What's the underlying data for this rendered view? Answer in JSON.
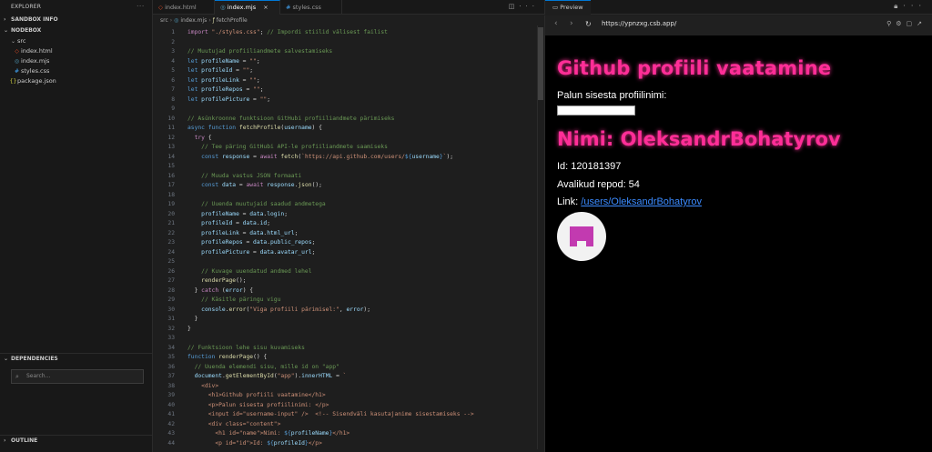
{
  "explorer": {
    "title": "EXPLORER",
    "sandbox_info": "SANDBOX INFO",
    "nodebox": "NODEBOX",
    "tree": [
      {
        "name": "src",
        "type": "folder"
      },
      {
        "name": "index.html",
        "type": "html"
      },
      {
        "name": "index.mjs",
        "type": "js"
      },
      {
        "name": "styles.css",
        "type": "css"
      },
      {
        "name": "package.json",
        "type": "json"
      }
    ],
    "dependencies": "DEPENDENCIES",
    "search_placeholder": "Search...",
    "outline": "OUTLINE"
  },
  "editor": {
    "tabs": [
      {
        "label": "index.html",
        "active": false
      },
      {
        "label": "index.mjs",
        "active": true
      },
      {
        "label": "styles.css",
        "active": false
      }
    ],
    "breadcrumb": [
      "src",
      "index.mjs",
      "fetchProfile"
    ],
    "lines": [
      {
        "n": "1",
        "html": "<span class='kw2'>import</span> <span class='str'>\"./styles.css\"</span>; <span class='com'>// Impordi stiilid välisest failist</span>"
      },
      {
        "n": "2",
        "html": ""
      },
      {
        "n": "3",
        "html": "<span class='com'>// Muutujad profiiliandmete salvestamiseks</span>"
      },
      {
        "n": "4",
        "html": "<span class='kw'>let</span> <span class='var'>profileName</span> = <span class='str'>\"\"</span>;"
      },
      {
        "n": "5",
        "html": "<span class='kw'>let</span> <span class='var'>profileId</span> = <span class='str'>\"\"</span>;"
      },
      {
        "n": "6",
        "html": "<span class='kw'>let</span> <span class='var'>profileLink</span> = <span class='str'>\"\"</span>;"
      },
      {
        "n": "7",
        "html": "<span class='kw'>let</span> <span class='var'>profileRepos</span> = <span class='str'>\"\"</span>;"
      },
      {
        "n": "8",
        "html": "<span class='kw'>let</span> <span class='var'>profilePicture</span> = <span class='str'>\"\"</span>;"
      },
      {
        "n": "9",
        "html": ""
      },
      {
        "n": "10",
        "html": "<span class='com'>// Asünkroonne funktsioon GitHubi profiiliandmete pärimiseks</span>"
      },
      {
        "n": "11",
        "html": "<span class='kw'>async</span> <span class='kw'>function</span> <span class='fn'>fetchProfile</span>(<span class='var'>username</span>) {"
      },
      {
        "n": "12",
        "html": "  <span class='kw2'>try</span> {"
      },
      {
        "n": "13",
        "html": "    <span class='com'>// Tee päring GitHubi API-le profiiliandmete saamiseks</span>"
      },
      {
        "n": "14",
        "html": "    <span class='kw'>const</span> <span class='var'>response</span> = <span class='kw2'>await</span> <span class='fn'>fetch</span>(<span class='str'>`https://api.github.com/users/</span><span class='kw'>${</span><span class='var'>username</span><span class='kw'>}</span><span class='str'>`</span>);"
      },
      {
        "n": "15",
        "html": ""
      },
      {
        "n": "16",
        "html": "    <span class='com'>// Muuda vastus JSON formaati</span>"
      },
      {
        "n": "17",
        "html": "    <span class='kw'>const</span> <span class='var'>data</span> = <span class='kw2'>await</span> <span class='var'>response</span>.<span class='fn'>json</span>();"
      },
      {
        "n": "18",
        "html": ""
      },
      {
        "n": "19",
        "html": "    <span class='com'>// Uuenda muutujaid saadud andmetega</span>"
      },
      {
        "n": "20",
        "html": "    <span class='var'>profileName</span> = <span class='var'>data</span>.<span class='var'>login</span>;"
      },
      {
        "n": "21",
        "html": "    <span class='var'>profileId</span> = <span class='var'>data</span>.<span class='var'>id</span>;"
      },
      {
        "n": "22",
        "html": "    <span class='var'>profileLink</span> = <span class='var'>data</span>.<span class='var'>html_url</span>;"
      },
      {
        "n": "23",
        "html": "    <span class='var'>profileRepos</span> = <span class='var'>data</span>.<span class='var'>public_repos</span>;"
      },
      {
        "n": "24",
        "html": "    <span class='var'>profilePicture</span> = <span class='var'>data</span>.<span class='var'>avatar_url</span>;"
      },
      {
        "n": "25",
        "html": ""
      },
      {
        "n": "26",
        "html": "    <span class='com'>// Kuvage uuendatud andmed lehel</span>"
      },
      {
        "n": "27",
        "html": "    <span class='fn'>renderPage</span>();"
      },
      {
        "n": "28",
        "html": "  } <span class='kw2'>catch</span> (<span class='var'>error</span>) {"
      },
      {
        "n": "29",
        "html": "    <span class='com'>// Käsitle päringu vigu</span>"
      },
      {
        "n": "30",
        "html": "    <span class='var'>console</span>.<span class='fn'>error</span>(<span class='str'>\"Viga profiili pärimisel:\"</span>, <span class='var'>error</span>);"
      },
      {
        "n": "31",
        "html": "  }"
      },
      {
        "n": "32",
        "html": "}"
      },
      {
        "n": "33",
        "html": ""
      },
      {
        "n": "34",
        "html": "<span class='com'>// Funktsioon lehe sisu kuvamiseks</span>"
      },
      {
        "n": "35",
        "html": "<span class='kw'>function</span> <span class='fn'>renderPage</span>() {"
      },
      {
        "n": "36",
        "html": "  <span class='com'>// Uuenda elemendi sisu, mille id on \"app\"</span>"
      },
      {
        "n": "37",
        "html": "  <span class='var'>document</span>.<span class='fn'>getElementById</span>(<span class='str'>\"app\"</span>).<span class='var'>innerHTML</span> = <span class='str'>`</span>"
      },
      {
        "n": "38",
        "html": "<span class='str'>    &lt;div&gt;</span>"
      },
      {
        "n": "39",
        "html": "<span class='str'>      &lt;h1&gt;Github profiili vaatamine&lt;/h1&gt;</span>"
      },
      {
        "n": "40",
        "html": "<span class='str'>      &lt;p&gt;Palun sisesta profiilinimi: &lt;/p&gt;</span>"
      },
      {
        "n": "41",
        "html": "<span class='str'>      &lt;input id=\"username-input\" /&gt;  &lt;!-- Sisendväli kasutajanime sisestamiseks --&gt;</span>"
      },
      {
        "n": "42",
        "html": "<span class='str'>      &lt;div class=\"content\"&gt;</span>"
      },
      {
        "n": "43",
        "html": "<span class='str'>        &lt;h1 id=\"name\"&gt;Nimi: </span><span class='kw'>${</span><span class='var'>profileName</span><span class='kw'>}</span><span class='str'>&lt;/h1&gt;</span>"
      },
      {
        "n": "44",
        "html": "<span class='str'>        &lt;p id=\"id\"&gt;Id: </span><span class='kw'>${</span><span class='var'>profileId</span><span class='kw'>}</span><span class='str'>&lt;/p&gt;</span>"
      }
    ]
  },
  "preview": {
    "tab_label": "Preview",
    "url": "https://ypnzxg.csb.app/",
    "page": {
      "title": "Github profiili vaatamine",
      "prompt": "Palun sisesta profiilinimi:",
      "input_value": "",
      "name_heading": "Nimi: OleksandrBohatyrov",
      "id_text": "Id: 120181397",
      "repos_text": "Avalikud repod: 54",
      "link_label": "Link: ",
      "link_text": "/users/OleksandrBohatyrov"
    }
  },
  "colors": {
    "accent": "#0078d4",
    "heading_pink": "#ff2e97",
    "link_blue": "#3b8bff",
    "avatar_purple": "#c23ab0"
  }
}
